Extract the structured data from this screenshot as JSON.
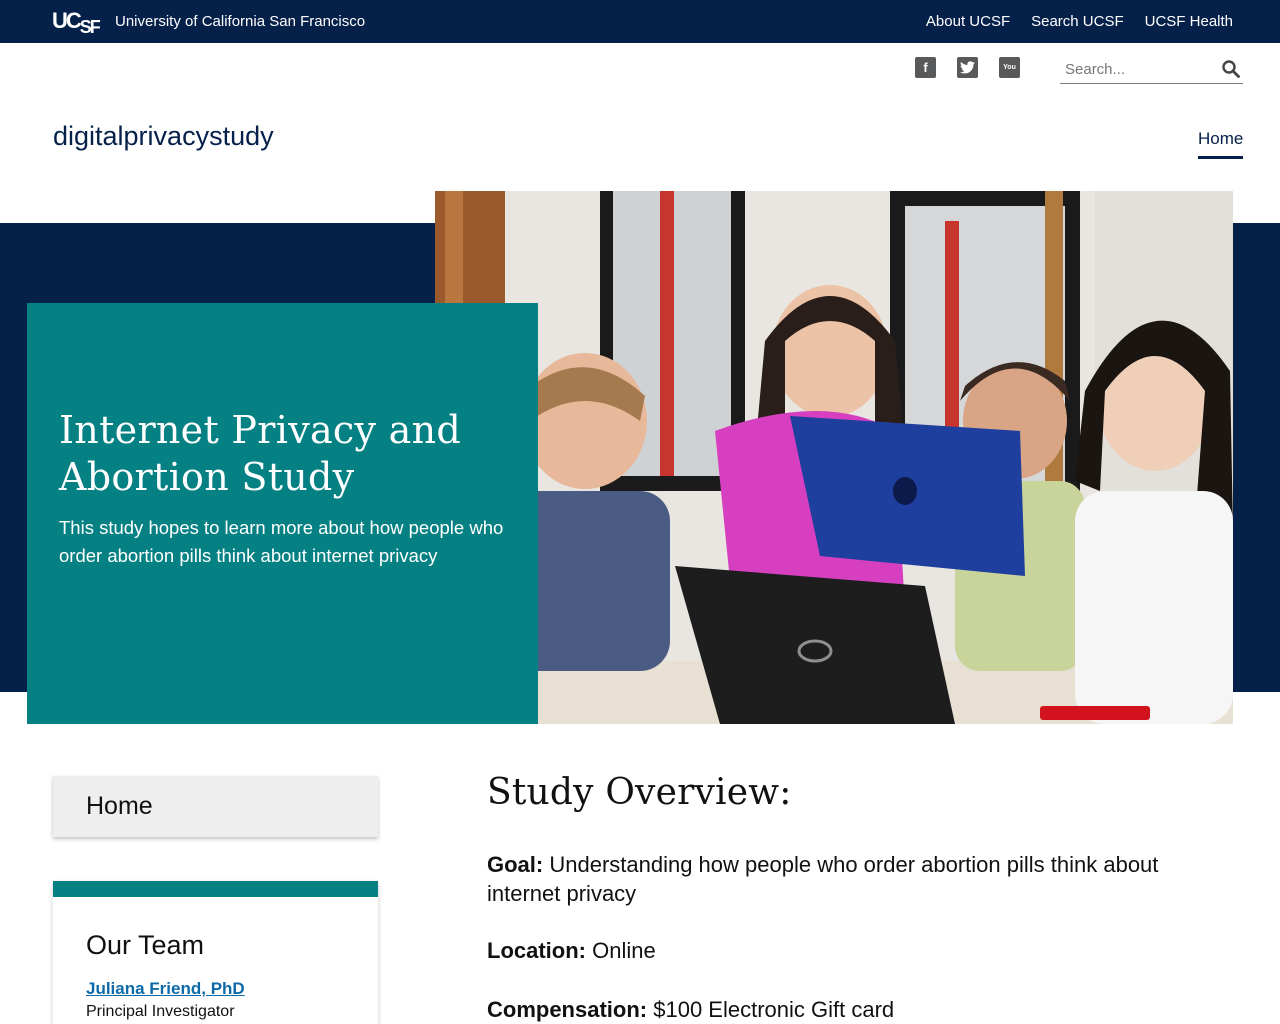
{
  "topbar": {
    "logo_main": "UC",
    "logo_sub": "SF",
    "university": "University of California San Francisco",
    "links": [
      "About UCSF",
      "Search UCSF",
      "UCSF Health"
    ]
  },
  "social": {
    "facebook": "f",
    "twitter": "t",
    "youtube": "You"
  },
  "search": {
    "placeholder": "Search..."
  },
  "site": {
    "name": "digitalprivacystudy"
  },
  "nav": {
    "home": "Home"
  },
  "hero": {
    "title": "Internet Privacy and Abortion Study",
    "subtitle": "This study hopes to learn more about how people who order abortion pills think about internet privacy"
  },
  "sidebar": {
    "home": "Home",
    "team_title": "Our Team",
    "person_name": "Juliana Friend, PhD",
    "person_role": "Principal Investigator"
  },
  "main": {
    "title": "Study Overview:",
    "goal_label": "Goal:",
    "goal_text": " Understanding how people who order abortion pills think about internet privacy",
    "location_label": "Location:",
    "location_text": " Online",
    "comp_label": "Compensation:",
    "comp_text": " $100 Electronic Gift card"
  },
  "colors": {
    "navy": "#052049",
    "teal": "#058183",
    "link": "#0d6aa8"
  }
}
